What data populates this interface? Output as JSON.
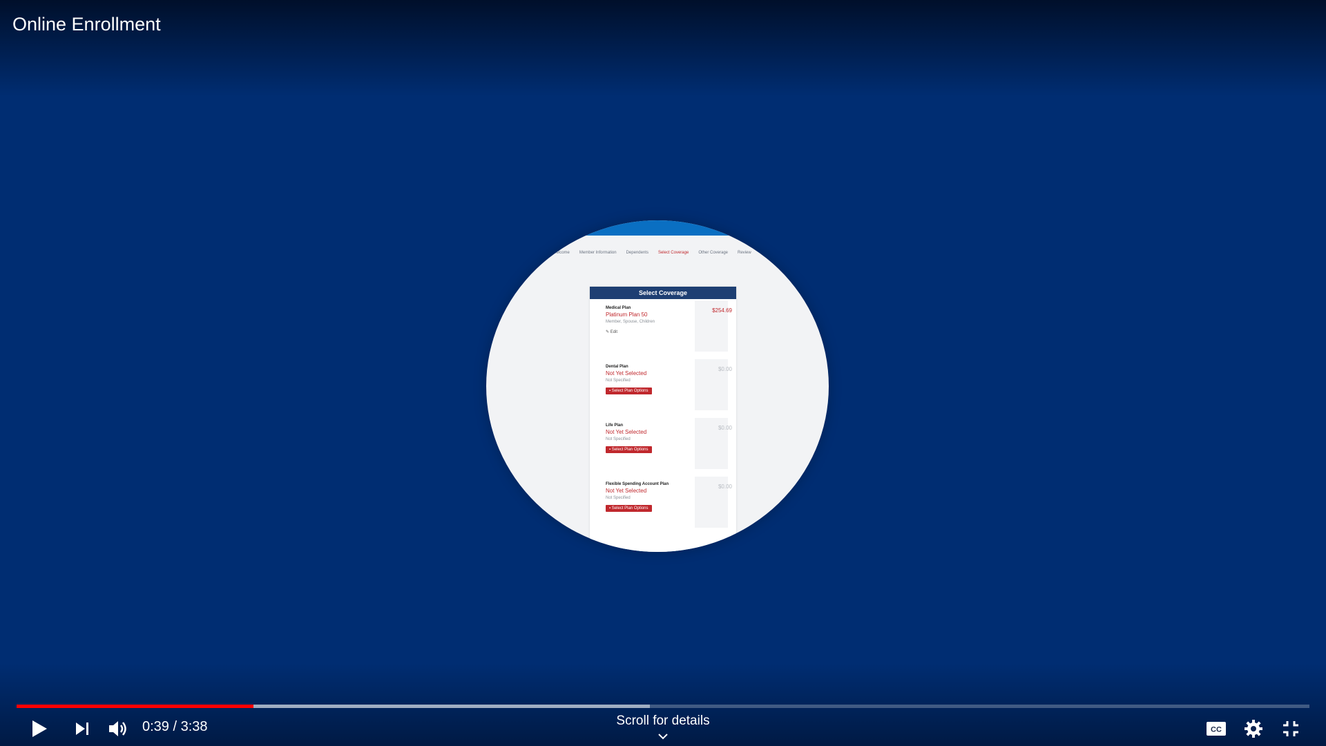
{
  "video": {
    "title": "Online Enrollment"
  },
  "lens": {
    "steps": [
      "Welcome",
      "Member Information",
      "Dependents",
      "Select Coverage",
      "Other Coverage",
      "Review"
    ],
    "active_step": 3,
    "card_title": "Select Coverage",
    "plans": [
      {
        "name": "Medical Plan",
        "status": "Platinum Plan 50",
        "sub": "Member, Spouse, Children",
        "action": "Edit",
        "price": "$254.69"
      },
      {
        "name": "Dental Plan",
        "status": "Not Yet Selected",
        "sub": "Not Specified",
        "action": "Select Plan Options",
        "price": "$0.00"
      },
      {
        "name": "Life Plan",
        "status": "Not Yet Selected",
        "sub": "Not Specified",
        "action": "Select Plan Options",
        "price": "$0.00"
      },
      {
        "name": "Flexible Spending Account Plan",
        "status": "Not Yet Selected",
        "sub": "Not Specified",
        "action": "Select Plan Options",
        "price": "$0.00"
      }
    ]
  },
  "controls": {
    "current_time": "0:39",
    "duration": "3:38",
    "time_text": "0:39 / 3:38",
    "played_fraction": 0.183,
    "buffered_fraction": 0.49,
    "scroll_hint": "Scroll for details",
    "icons": {
      "play": "play-icon",
      "next": "next-icon",
      "volume": "volume-icon",
      "captions": "captions-icon",
      "settings": "gear-icon",
      "exit_fullscreen": "exit-fullscreen-icon"
    }
  },
  "colors": {
    "background": "#002d72",
    "progress_played": "#ff0000",
    "accent_red": "#c0282d",
    "card_header": "#1e3f73",
    "topbar": "#0a6fc2"
  }
}
